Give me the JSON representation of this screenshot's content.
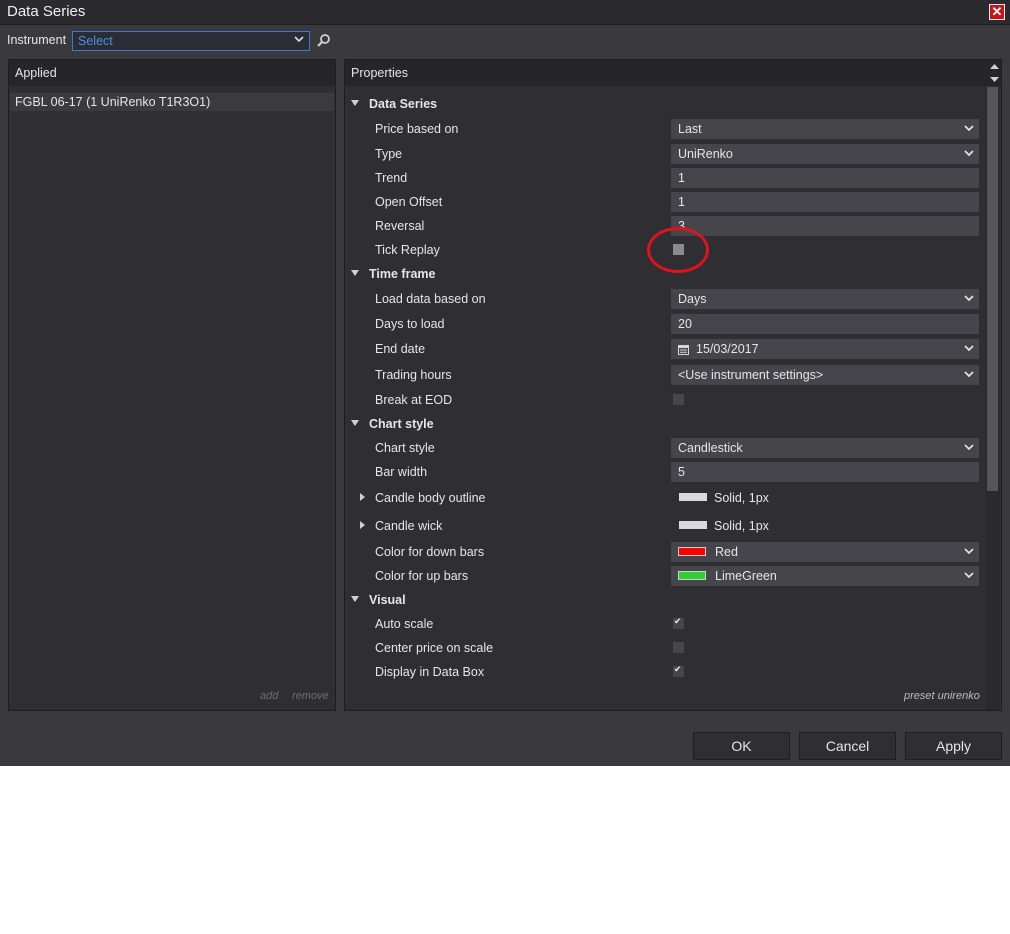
{
  "window": {
    "title": "Data Series"
  },
  "instrument": {
    "label": "Instrument",
    "value": "Select"
  },
  "applied": {
    "header": "Applied",
    "items": [
      "FGBL 06-17 (1 UniRenko T1R3O1)"
    ],
    "add_label": "add",
    "remove_label": "remove"
  },
  "properties": {
    "header": "Properties",
    "preset_label": "preset unirenko",
    "data_series": {
      "title": "Data Series",
      "price_based_on": {
        "label": "Price based on",
        "value": "Last"
      },
      "type": {
        "label": "Type",
        "value": "UniRenko"
      },
      "trend": {
        "label": "Trend",
        "value": "1"
      },
      "open_offset": {
        "label": "Open Offset",
        "value": "1"
      },
      "reversal": {
        "label": "Reversal",
        "value": "3"
      },
      "tick_replay": {
        "label": "Tick Replay",
        "checked": false
      }
    },
    "time_frame": {
      "title": "Time frame",
      "load_data_based_on": {
        "label": "Load data based on",
        "value": "Days"
      },
      "days_to_load": {
        "label": "Days to load",
        "value": "20"
      },
      "end_date": {
        "label": "End date",
        "value": "15/03/2017"
      },
      "trading_hours": {
        "label": "Trading hours",
        "value": "<Use instrument settings>"
      },
      "break_at_eod": {
        "label": "Break at EOD",
        "checked": false
      }
    },
    "chart_style": {
      "title": "Chart style",
      "chart_style": {
        "label": "Chart style",
        "value": "Candlestick"
      },
      "bar_width": {
        "label": "Bar width",
        "value": "5"
      },
      "candle_body_outline": {
        "label": "Candle body outline",
        "value": "Solid, 1px"
      },
      "candle_wick": {
        "label": "Candle wick",
        "value": "Solid, 1px"
      },
      "color_down": {
        "label": "Color for down bars",
        "value": "Red",
        "color": "#ff0000"
      },
      "color_up": {
        "label": "Color for up bars",
        "value": "LimeGreen",
        "color": "#32cd32"
      }
    },
    "visual": {
      "title": "Visual",
      "auto_scale": {
        "label": "Auto scale",
        "checked": true
      },
      "center_price": {
        "label": "Center price on scale",
        "checked": false
      },
      "display_data_box": {
        "label": "Display in Data Box",
        "checked": true
      }
    }
  },
  "buttons": {
    "ok": "OK",
    "cancel": "Cancel",
    "apply": "Apply"
  },
  "annotation": {
    "color": "#e0121b"
  }
}
